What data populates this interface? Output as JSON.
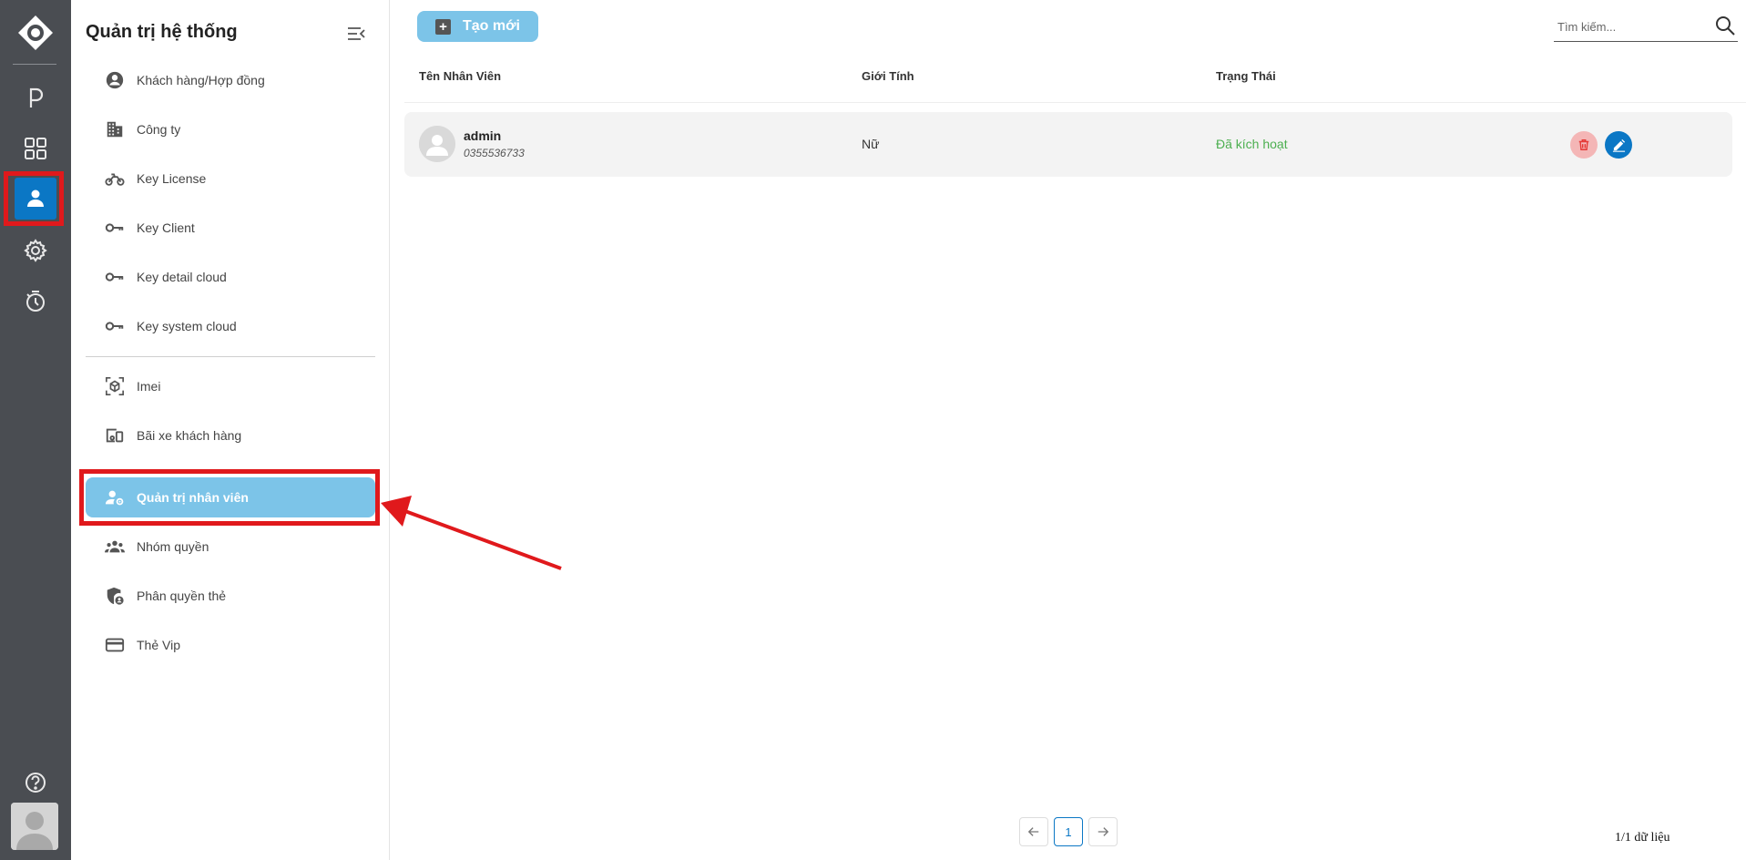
{
  "sidebar": {
    "title": "Quản trị hệ thống",
    "items": [
      {
        "label": "Khách hàng/Hợp đồng"
      },
      {
        "label": "Công ty"
      },
      {
        "label": "Key License"
      },
      {
        "label": "Key Client"
      },
      {
        "label": "Key detail cloud"
      },
      {
        "label": "Key system cloud"
      },
      {
        "label": "Imei"
      },
      {
        "label": "Bãi xe khách hàng"
      },
      {
        "label": "Quản trị nhân viên"
      },
      {
        "label": "Nhóm quyền"
      },
      {
        "label": "Phân quyền thẻ"
      },
      {
        "label": "Thẻ Vip"
      }
    ],
    "active_item": "Quản trị nhân viên"
  },
  "toolbar": {
    "create_label": "Tạo mới"
  },
  "search": {
    "placeholder": "Tìm kiếm..."
  },
  "table": {
    "headers": [
      "Tên Nhân Viên",
      "Giới Tính",
      "Trạng Thái"
    ],
    "rows": [
      {
        "name": "admin",
        "phone": "0355536733",
        "gender": "Nữ",
        "status": "Đã kích hoạt"
      }
    ]
  },
  "pagination": {
    "current_page": "1",
    "summary": "1/1 dữ liệu"
  },
  "colors": {
    "rail_bg": "#4a4d52",
    "accent": "#0b77c5",
    "active_item_bg": "#7cc4e8",
    "status_active": "#4caf50",
    "annotation": "#e0191c"
  }
}
